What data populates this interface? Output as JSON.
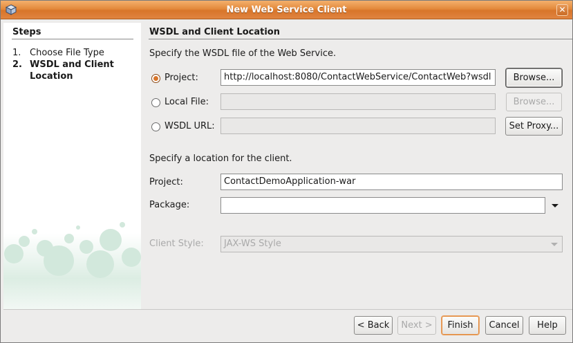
{
  "window": {
    "title": "New Web Service Client"
  },
  "steps": {
    "title": "Steps",
    "items": [
      {
        "num": "1.",
        "label": "Choose File Type"
      },
      {
        "num": "2.",
        "label": "WSDL and Client Location"
      }
    ]
  },
  "panel": {
    "title": "WSDL and Client Location",
    "wsdl_instruction": "Specify the WSDL file of the Web Service.",
    "project_radio_label": "Project:",
    "project_wsdl_value": "http://localhost:8080/ContactWebService/ContactWeb?wsdl",
    "browse_label": "Browse...",
    "local_file_radio_label": "Local File:",
    "local_file_value": "",
    "browse_disabled_label": "Browse...",
    "wsdl_url_radio_label": "WSDL URL:",
    "wsdl_url_value": "",
    "set_proxy_label": "Set Proxy...",
    "location_instruction": "Specify a location for the client.",
    "client_project_label": "Project:",
    "client_project_value": "ContactDemoApplication-war",
    "package_label": "Package:",
    "package_value": "",
    "client_style_label": "Client Style:",
    "client_style_value": "JAX-WS Style"
  },
  "footer": {
    "back_label": "< Back",
    "next_label": "Next >",
    "finish_label": "Finish",
    "cancel_label": "Cancel",
    "help_label": "Help"
  },
  "colors": {
    "titlebar": "#e38a3c",
    "accent": "#d8752a",
    "panel_bg": "#edeceb"
  },
  "icons": {
    "window_icon": "cube-icon",
    "close": "close-icon"
  }
}
